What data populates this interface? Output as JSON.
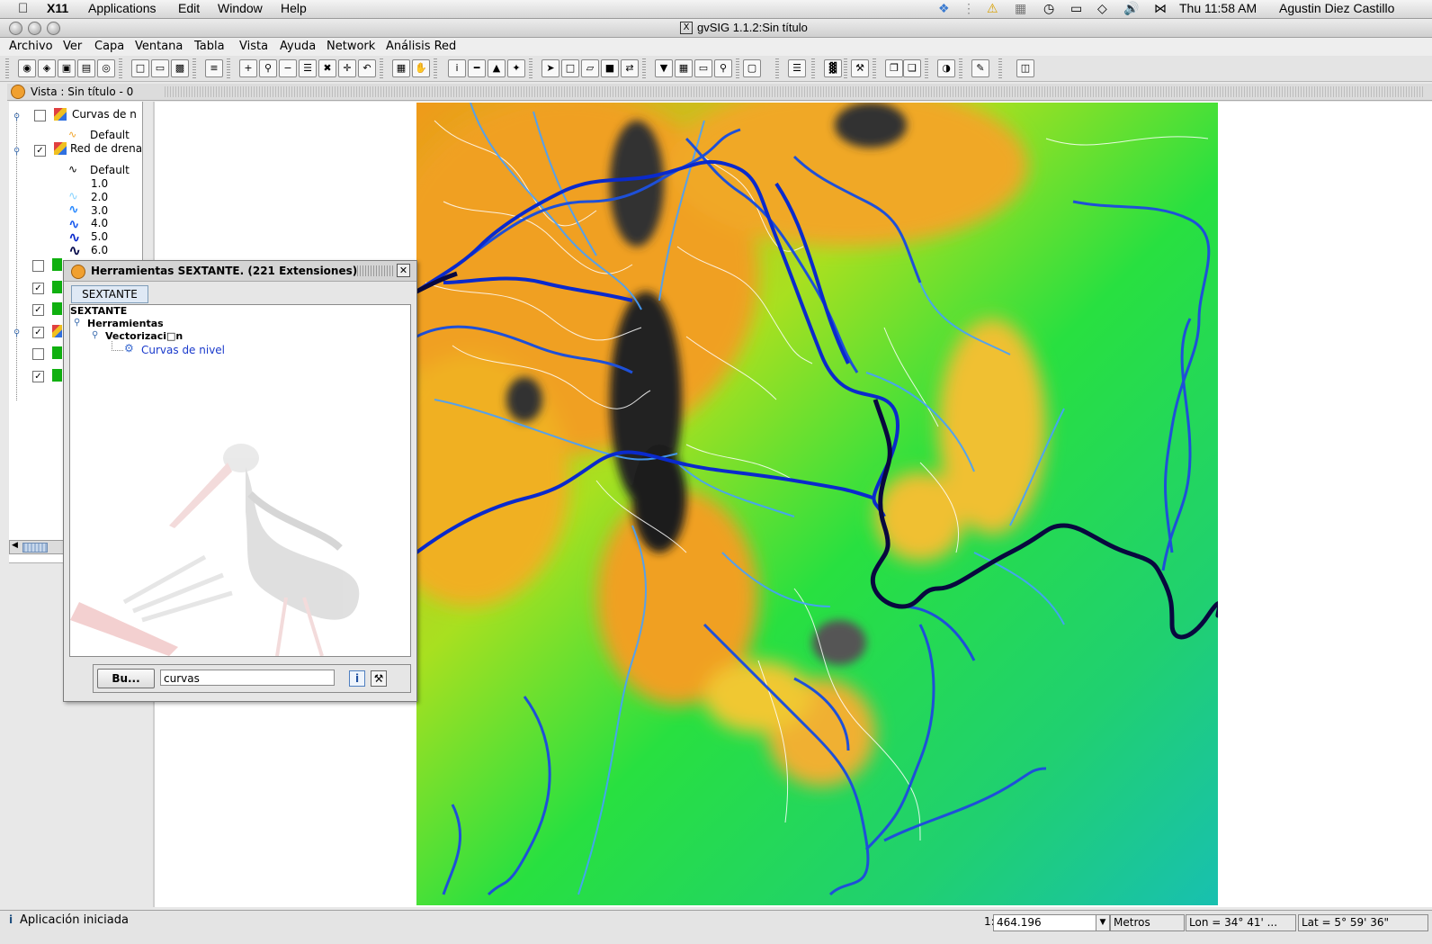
{
  "mac_menubar": {
    "app": "X11",
    "items": [
      "Applications",
      "Edit",
      "Window",
      "Help"
    ],
    "clock": "Thu 11:58 AM",
    "user": "Agustin Diez Castillo"
  },
  "window": {
    "title": "gvSIG 1.1.2:Sin título"
  },
  "app_menu": [
    "Archivo",
    "Ver",
    "Capa",
    "Ventana",
    "Tabla",
    "Vista",
    "Ayuda",
    "Network",
    "Análisis Red"
  ],
  "view": {
    "title": "Vista : Sin título - 0"
  },
  "toc": {
    "layers": [
      {
        "name": "Curvas de n",
        "checked": false
      },
      {
        "name": "Red de drena",
        "checked": true
      }
    ],
    "curvas_default": "Default",
    "red_default": "Default",
    "legend_values": [
      "1.0",
      "2.0",
      "3.0",
      "4.0",
      "5.0",
      "6.0"
    ],
    "legend_colors": [
      "#8ad4ff",
      "#5ab4ff",
      "#2a8aff",
      "#1a5aee",
      "#0a2acc",
      "#060a4a"
    ],
    "extra_checks": [
      false,
      true,
      true,
      true,
      false,
      true
    ]
  },
  "sextante": {
    "title": "Herramientas SEXTANTE. (221 Extensiones)",
    "tab": "SEXTANTE",
    "tree_root": "SEXTANTE",
    "tree_group": "Herramientas",
    "tree_sub": "Vectorizaci□n",
    "tree_leaf": "Curvas de nivel",
    "search_button": "Bu...",
    "search_value": "curvas"
  },
  "status": {
    "message": "Aplicación iniciada",
    "scale_prefix": "1:",
    "scale": "464.196",
    "units": "Metros",
    "lon": "Lon = 34° 41' ...",
    "lat": "Lat = 5° 59' 36\""
  },
  "colors": {
    "river_dark": "#0a0a50",
    "river_blue": "#1e50d8",
    "river_light": "#46a0ff",
    "terrain_high": "#111111",
    "terrain_orange": "#f0a020",
    "terrain_green": "#20e040",
    "terrain_cyan": "#20c8a0"
  }
}
